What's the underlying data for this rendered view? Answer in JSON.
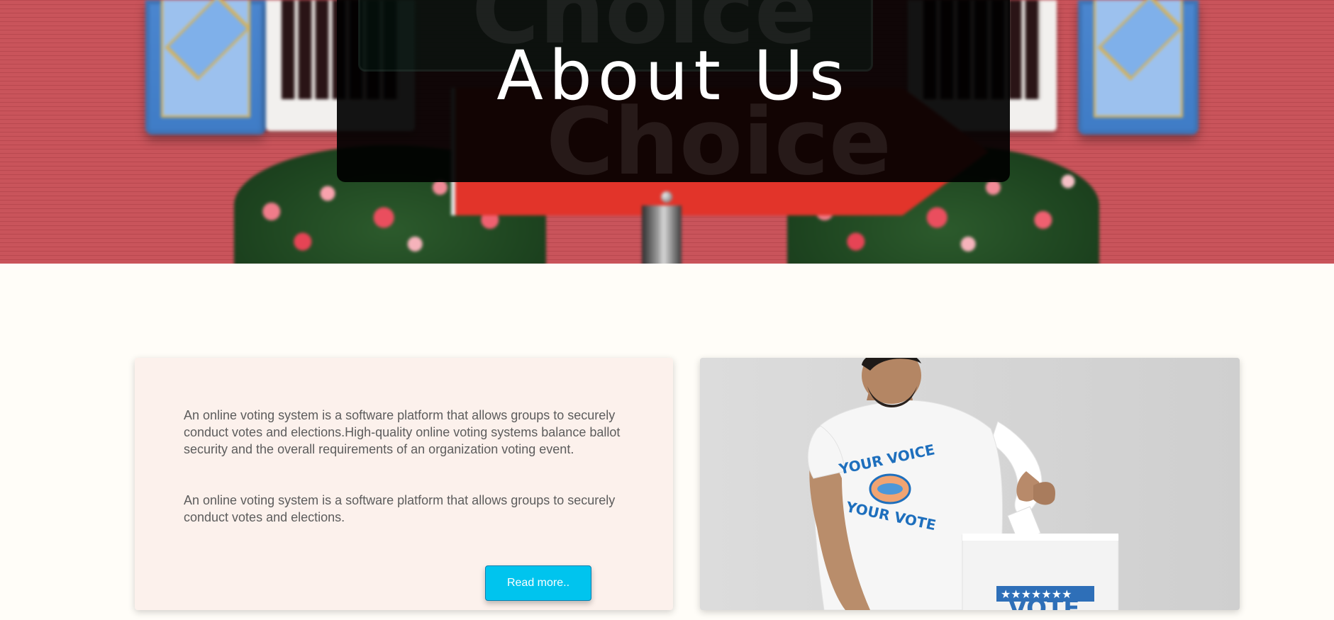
{
  "hero": {
    "title": "About Us",
    "background_sign_text": "Choice"
  },
  "about": {
    "paragraph_1": "An online voting system is a software platform that allows groups to securely conduct votes and elections.High-quality online voting systems balance ballot security and the overall requirements of an organization voting event.",
    "paragraph_2": "An online voting system is a software platform that allows groups to securely conduct votes and elections.",
    "read_more_label": "Read more.."
  },
  "photo": {
    "shirt_text_top": "YOUR VOICE",
    "shirt_text_bottom": "YOUR VOTE",
    "ballot_box_text": "VOTE"
  },
  "colors": {
    "page_background": "#fffdf8",
    "text_card_background": "#fcf1ec",
    "button_background": "#00c4ee",
    "body_text": "#5c5c5c"
  }
}
